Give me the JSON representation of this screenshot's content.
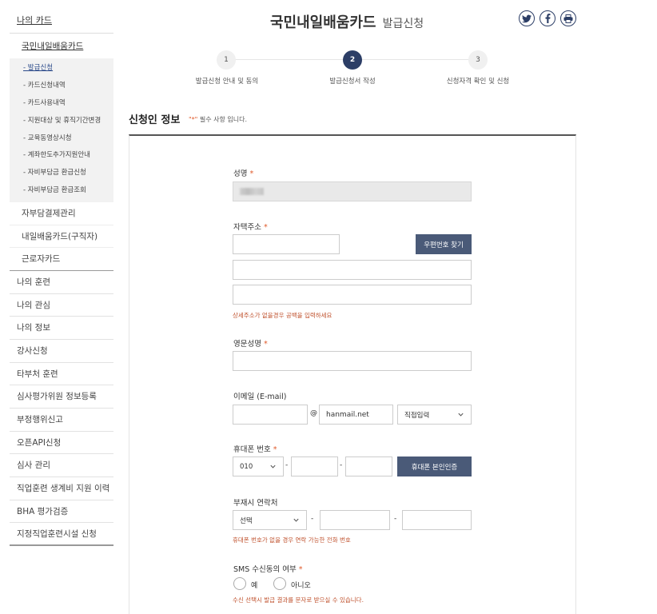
{
  "sidebar": {
    "top": "나의 카드",
    "card_name": "국민내일배움카드",
    "card_subitems": [
      {
        "label": "- 발급신청",
        "active": true
      },
      {
        "label": "- 카드신청내역"
      },
      {
        "label": "- 카드사용내역"
      },
      {
        "label": "- 지원대상 및 휴직기간변경"
      },
      {
        "label": "- 교육동영상시청"
      },
      {
        "label": "- 계좌한도추가지원안내"
      },
      {
        "label": "- 자비부담금 환급신청"
      },
      {
        "label": "- 자비부담금 환급조회"
      }
    ],
    "card_sections": [
      "자부담결제관리",
      "내일배움카드(구직자)",
      "근로자카드"
    ],
    "main_items": [
      "나의 훈련",
      "나의 관심",
      "나의 정보",
      "강사신청",
      "타부처 훈련",
      "심사평가위원 정보등록",
      "부정행위신고",
      "오픈API신청",
      "심사 관리",
      "직업훈련 생계비 지원 이력",
      "BHA 평가검증",
      "지정직업훈련시설 신청"
    ]
  },
  "header": {
    "title": "국민내일배움카드",
    "subtitle": "발급신청",
    "share_icons": [
      "twitter-icon",
      "facebook-icon",
      "print-icon"
    ],
    "icon_color": "#2c3e66"
  },
  "steps": [
    {
      "num": "1",
      "label": "발급신청 안내 및 동의"
    },
    {
      "num": "2",
      "label": "발급신청서 작성",
      "active": true
    },
    {
      "num": "3",
      "label": "신청자격 확인 및 신청"
    }
  ],
  "section": {
    "title": "신청인 정보",
    "req_mark": "\"*\"",
    "req_text": " 필수 사항 입니다."
  },
  "form": {
    "name_label": "성명",
    "address_label": "자택주소",
    "zip_button": "우편번호 찾기",
    "address_help": "상세주소가 없을경우 공백을 입력하세요",
    "eng_name_label": "영문성명",
    "email_label": "이메일 (E-mail)",
    "email_at": "@",
    "email_domain": "hanmail.net",
    "email_select": "직접입력",
    "phone_label": "휴대폰 번호",
    "phone_prefix": "010",
    "phone_dash": "-",
    "phone_verify_button": "휴대폰 본인인증",
    "alt_phone_label": "부재시 연락처",
    "alt_select": "선택",
    "alt_help": "휴대폰 번호가 없을 경우 연락 가능한 전화 번호",
    "sms_label": "SMS 수신동의 여부",
    "sms_yes": "예",
    "sms_no": "아니오",
    "sms_help": "수신 선택시 발급 결과를 문자로 받으실 수 있습니다.",
    "required_star": "*"
  },
  "colors": {
    "accent": "#2c3e66",
    "button": "#4a5a78",
    "required": "#e05a2b",
    "help": "#c0532f"
  }
}
